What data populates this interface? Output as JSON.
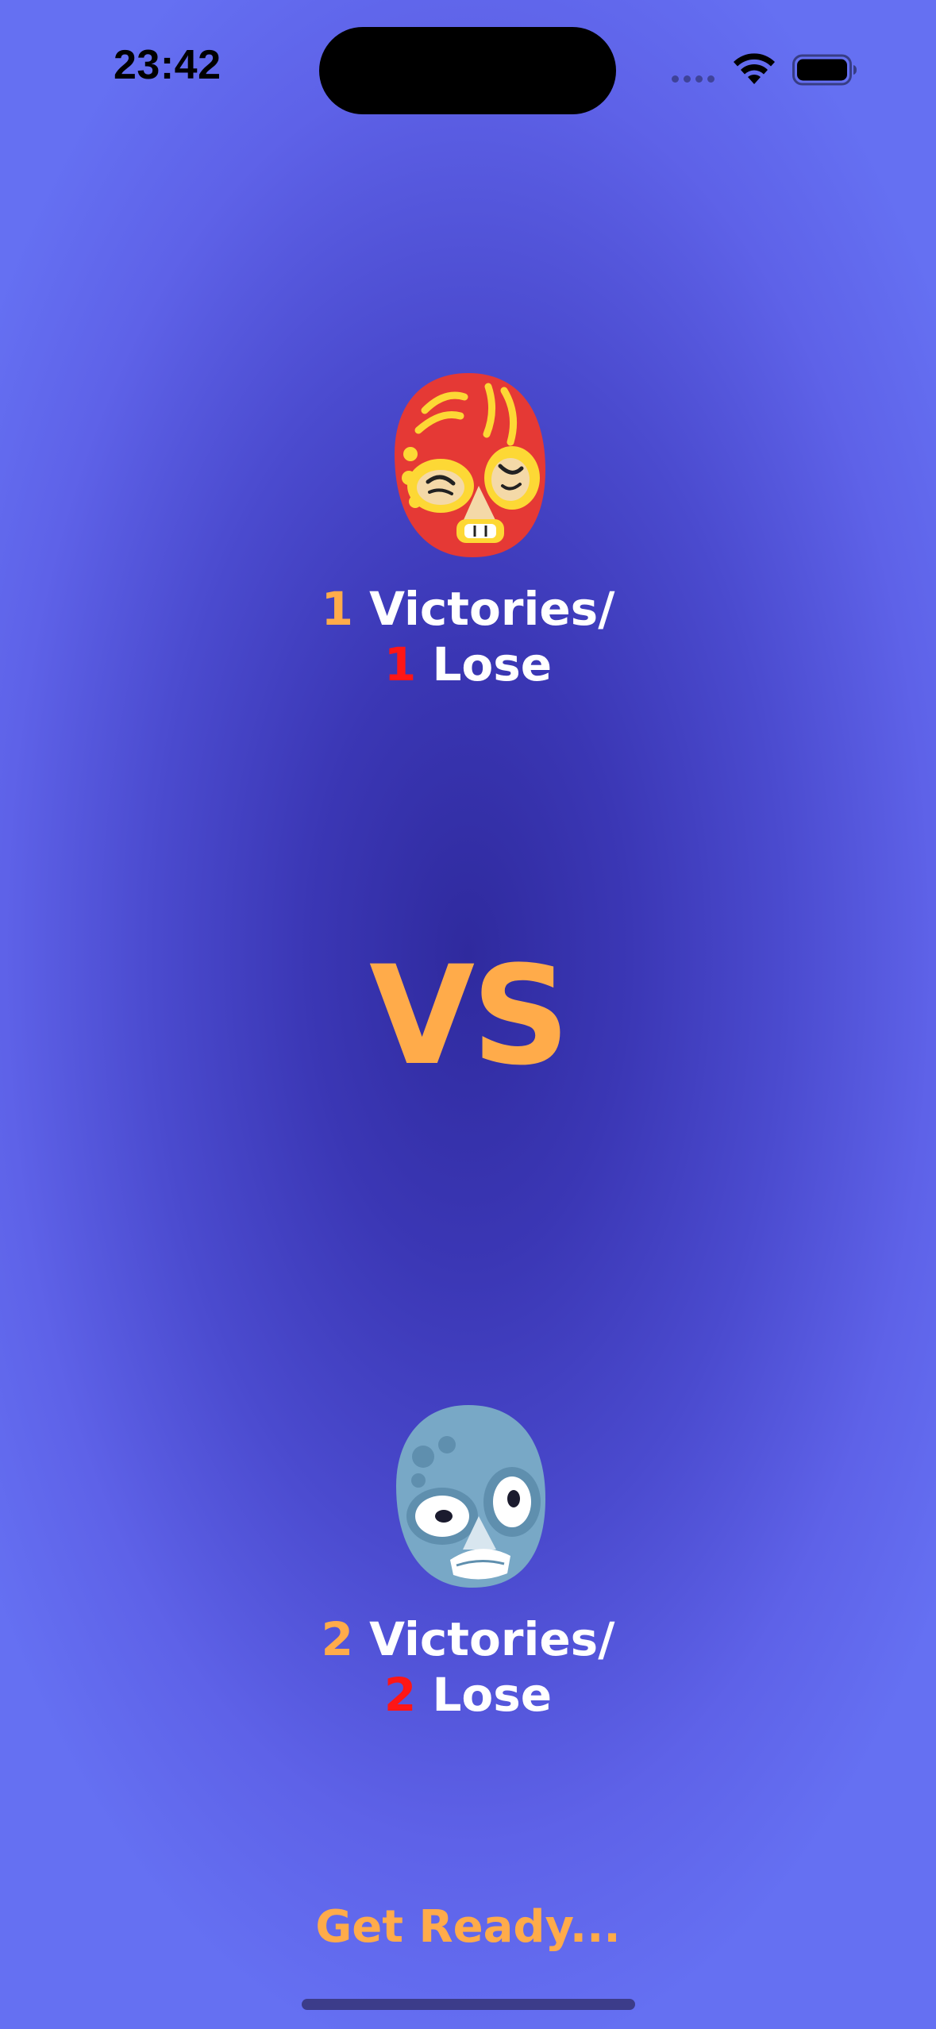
{
  "status_bar": {
    "time": "23:42",
    "icons": [
      "cellular-signal-icon",
      "wifi-icon",
      "battery-icon"
    ]
  },
  "colors": {
    "accent_orange": "#ffab4a",
    "loss_red": "#ff1616",
    "background_center": "#2f2a9e",
    "background_edge": "#6570f2"
  },
  "player_one": {
    "avatar_icon": "red-luchador-mask-icon",
    "wins": "1",
    "wins_label": "Victories/",
    "losses": "1",
    "losses_label": "Lose"
  },
  "vs_label": "VS",
  "player_two": {
    "avatar_icon": "blue-luchador-mask-icon",
    "wins": "2",
    "wins_label": "Victories/",
    "losses": "2",
    "losses_label": "Lose"
  },
  "footer": {
    "status": "Get Ready..."
  }
}
